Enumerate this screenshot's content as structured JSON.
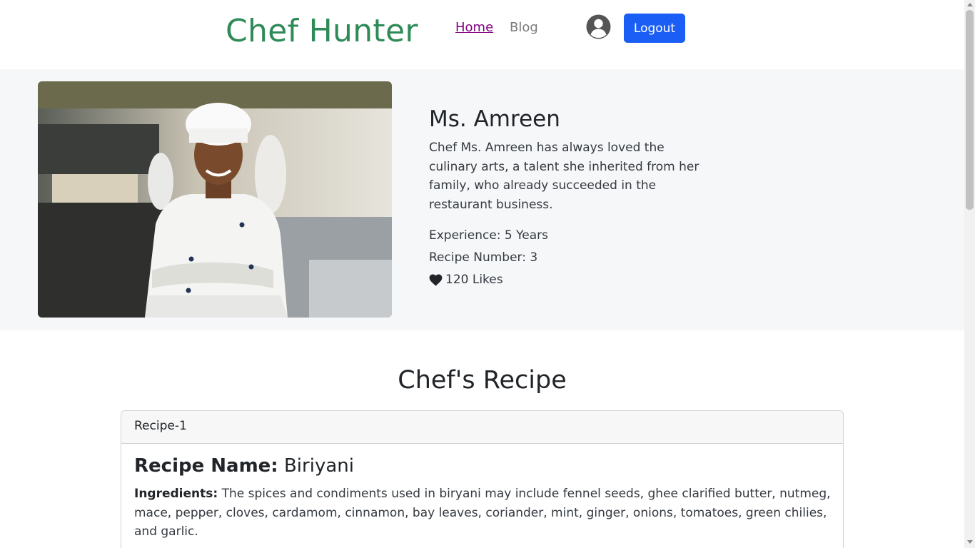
{
  "brand": "Chef Hunter",
  "nav": {
    "home": "Home",
    "blog": "Blog"
  },
  "logout_label": "Logout",
  "chef": {
    "name": "Ms. Amreen",
    "bio": "Chef Ms. Amreen has always loved the culinary arts, a talent she inherited from her family, who already succeeded in the restaurant business.",
    "experience": "Experience: 5 Years",
    "recipe_number": "Recipe Number: 3",
    "likes": "120 Likes"
  },
  "recipes_section": {
    "title": "Chef's Recipe",
    "recipe": {
      "header": "Recipe-1",
      "name_label": "Recipe Name:",
      "name": "Biriyani",
      "ingredients_label": "Ingredients:",
      "ingredients": "The spices and condiments used in biryani may include fennel seeds, ghee clarified butter, nutmeg, mace, pepper, cloves, cardamom, cinnamon, bay leaves, coriander, mint, ginger, onions, tomatoes, green chilies, and garlic."
    }
  },
  "colors": {
    "brand": "#2e8b57",
    "primary_button": "#1a5ef5",
    "section_bg": "#f6f7f9",
    "visited_link": "#800080"
  },
  "icons": {
    "avatar": "user-circle-icon",
    "likes": "heart-icon"
  }
}
